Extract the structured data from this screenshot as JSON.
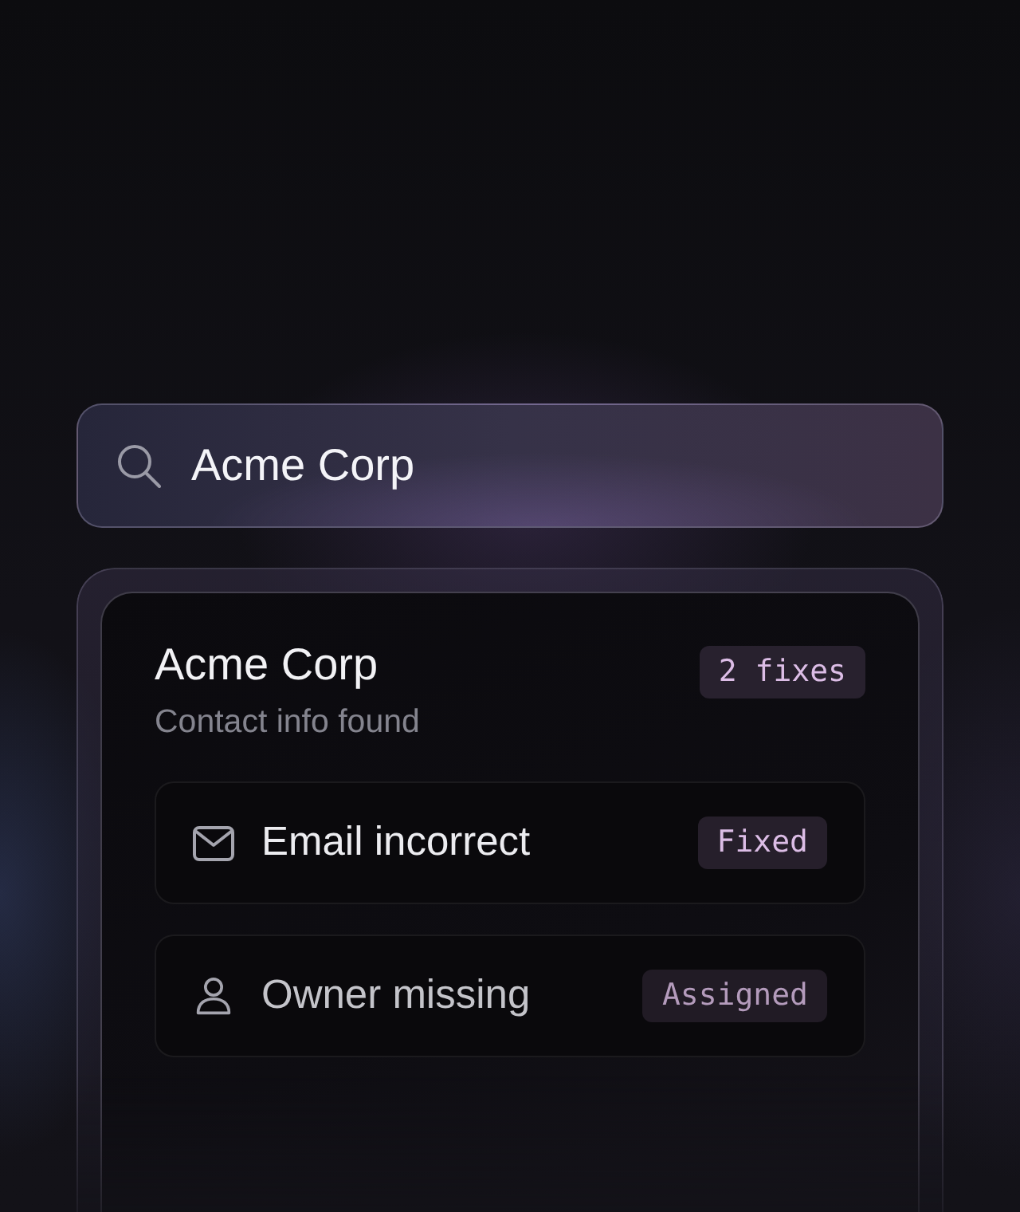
{
  "search": {
    "value": "Acme Corp"
  },
  "result": {
    "title": "Acme Corp",
    "subtitle": "Contact info found",
    "badge": "2 fixes",
    "issues": [
      {
        "kind": "mail",
        "label": "Email incorrect",
        "status": "Fixed",
        "muted": false
      },
      {
        "kind": "person",
        "label": "Owner missing",
        "status": "Assigned",
        "muted": true
      }
    ]
  }
}
